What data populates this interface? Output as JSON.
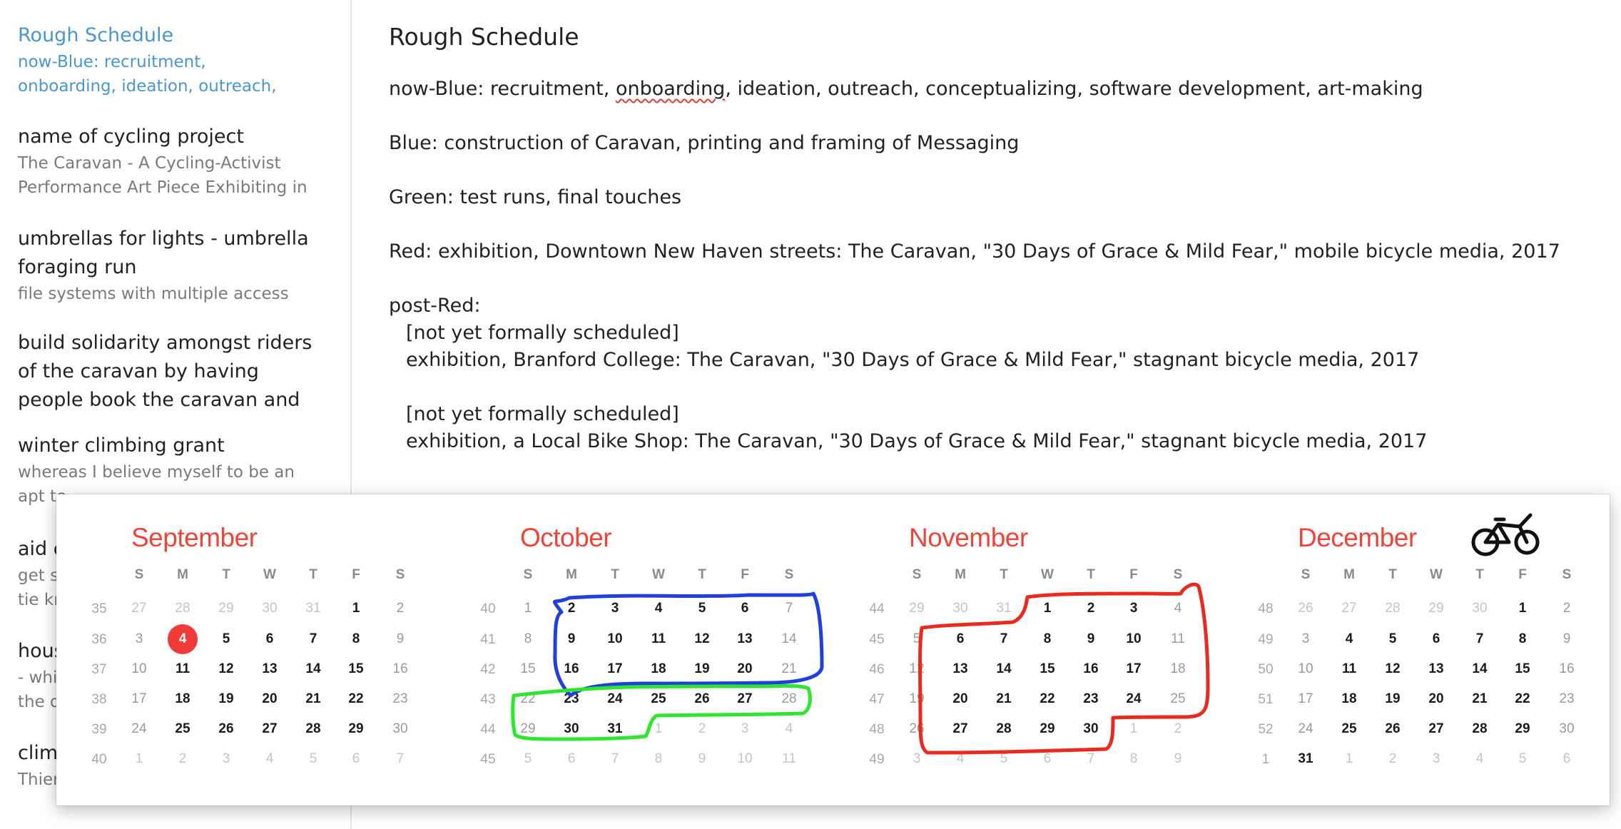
{
  "sidebar": {
    "notes": [
      {
        "title": "Rough Schedule",
        "preview": "now-Blue: recruitment,\nonboarding, ideation, outreach,",
        "active": true
      },
      {
        "title": "name of cycling project",
        "preview": "The Caravan - A Cycling-Activist\nPerformance Art Piece Exhibiting in"
      },
      {
        "title": "umbrellas for lights - umbrella\nforaging run",
        "preview": "file systems with multiple access"
      },
      {
        "title": "build solidarity amongst riders\nof the caravan by having\npeople book the caravan and",
        "preview": ""
      },
      {
        "title": "winter climbing grant",
        "preview": "whereas I believe myself to be an\napt te"
      },
      {
        "title": "aid c",
        "preview": "get sc\ntie kn"
      },
      {
        "title": "hous",
        "preview": "- whic\nthe d"
      },
      {
        "title": "clim",
        "preview": "Thier"
      }
    ]
  },
  "editor": {
    "title": "Rough Schedule",
    "line_now_blue_pre": "now-Blue: recruitment, ",
    "line_now_blue_misspelled": "onboarding",
    "line_now_blue_post": ", ideation, outreach, conceptualizing, software development, art-making",
    "line_blue": "Blue: construction of Caravan, printing and framing of Messaging",
    "line_green": "Green: test runs, final touches",
    "line_red": "Red: exhibition, Downtown New Haven streets: The Caravan, \"30 Days of Grace & Mild Fear,\" mobile bicycle media, 2017",
    "post_red_heading": "post-Red:",
    "post_red_1_status": "[not yet formally scheduled]",
    "post_red_1_detail": "exhibition, Branford College: The Caravan, \"30 Days of Grace & Mild Fear,\" stagnant bicycle media, 2017",
    "post_red_2_status": "[not yet formally scheduled]",
    "post_red_2_detail": "exhibition, a Local Bike Shop: The Caravan, \"30 Days of Grace & Mild Fear,\" stagnant bicycle media, 2017"
  },
  "calendar": {
    "weekday_labels": [
      "S",
      "M",
      "T",
      "W",
      "T",
      "F",
      "S"
    ],
    "today_color": "#ef3b36",
    "month_color": "#f0433a",
    "months": [
      {
        "name": "September",
        "weeks": [
          {
            "wk": "35",
            "days": [
              [
                "27",
                "dim"
              ],
              [
                "28",
                "dim"
              ],
              [
                "29",
                "dim"
              ],
              [
                "30",
                "dim"
              ],
              [
                "31",
                "dim"
              ],
              [
                "1",
                ""
              ],
              [
                "2",
                "weekend"
              ]
            ]
          },
          {
            "wk": "36",
            "days": [
              [
                "3",
                "weekend"
              ],
              [
                "4",
                "today"
              ],
              [
                "5",
                ""
              ],
              [
                "6",
                ""
              ],
              [
                "7",
                ""
              ],
              [
                "8",
                ""
              ],
              [
                "9",
                "weekend"
              ]
            ]
          },
          {
            "wk": "37",
            "days": [
              [
                "10",
                "weekend"
              ],
              [
                "11",
                ""
              ],
              [
                "12",
                ""
              ],
              [
                "13",
                ""
              ],
              [
                "14",
                ""
              ],
              [
                "15",
                ""
              ],
              [
                "16",
                "weekend"
              ]
            ]
          },
          {
            "wk": "38",
            "days": [
              [
                "17",
                "weekend"
              ],
              [
                "18",
                ""
              ],
              [
                "19",
                ""
              ],
              [
                "20",
                ""
              ],
              [
                "21",
                ""
              ],
              [
                "22",
                ""
              ],
              [
                "23",
                "weekend"
              ]
            ]
          },
          {
            "wk": "39",
            "days": [
              [
                "24",
                "weekend"
              ],
              [
                "25",
                ""
              ],
              [
                "26",
                ""
              ],
              [
                "27",
                ""
              ],
              [
                "28",
                ""
              ],
              [
                "29",
                ""
              ],
              [
                "30",
                "weekend"
              ]
            ]
          },
          {
            "wk": "40",
            "days": [
              [
                "1",
                "dim"
              ],
              [
                "2",
                "dim"
              ],
              [
                "3",
                "dim"
              ],
              [
                "4",
                "dim"
              ],
              [
                "5",
                "dim"
              ],
              [
                "6",
                "dim"
              ],
              [
                "7",
                "dim"
              ]
            ]
          }
        ]
      },
      {
        "name": "October",
        "weeks": [
          {
            "wk": "40",
            "days": [
              [
                "1",
                "weekend"
              ],
              [
                "2",
                ""
              ],
              [
                "3",
                ""
              ],
              [
                "4",
                ""
              ],
              [
                "5",
                ""
              ],
              [
                "6",
                ""
              ],
              [
                "7",
                "weekend"
              ]
            ]
          },
          {
            "wk": "41",
            "days": [
              [
                "8",
                "weekend"
              ],
              [
                "9",
                ""
              ],
              [
                "10",
                ""
              ],
              [
                "11",
                ""
              ],
              [
                "12",
                ""
              ],
              [
                "13",
                ""
              ],
              [
                "14",
                "weekend"
              ]
            ]
          },
          {
            "wk": "42",
            "days": [
              [
                "15",
                "weekend"
              ],
              [
                "16",
                ""
              ],
              [
                "17",
                ""
              ],
              [
                "18",
                ""
              ],
              [
                "19",
                ""
              ],
              [
                "20",
                ""
              ],
              [
                "21",
                "weekend"
              ]
            ]
          },
          {
            "wk": "43",
            "days": [
              [
                "22",
                "weekend"
              ],
              [
                "23",
                ""
              ],
              [
                "24",
                ""
              ],
              [
                "25",
                ""
              ],
              [
                "26",
                ""
              ],
              [
                "27",
                ""
              ],
              [
                "28",
                "weekend"
              ]
            ]
          },
          {
            "wk": "44",
            "days": [
              [
                "29",
                "weekend"
              ],
              [
                "30",
                ""
              ],
              [
                "31",
                ""
              ],
              [
                "1",
                "dim"
              ],
              [
                "2",
                "dim"
              ],
              [
                "3",
                "dim"
              ],
              [
                "4",
                "dim"
              ]
            ]
          },
          {
            "wk": "45",
            "days": [
              [
                "5",
                "dim"
              ],
              [
                "6",
                "dim"
              ],
              [
                "7",
                "dim"
              ],
              [
                "8",
                "dim"
              ],
              [
                "9",
                "dim"
              ],
              [
                "10",
                "dim"
              ],
              [
                "11",
                "dim"
              ]
            ]
          }
        ]
      },
      {
        "name": "November",
        "weeks": [
          {
            "wk": "44",
            "days": [
              [
                "29",
                "dim"
              ],
              [
                "30",
                "dim"
              ],
              [
                "31",
                "dim"
              ],
              [
                "1",
                ""
              ],
              [
                "2",
                ""
              ],
              [
                "3",
                ""
              ],
              [
                "4",
                "weekend"
              ]
            ]
          },
          {
            "wk": "45",
            "days": [
              [
                "5",
                "weekend"
              ],
              [
                "6",
                ""
              ],
              [
                "7",
                ""
              ],
              [
                "8",
                ""
              ],
              [
                "9",
                ""
              ],
              [
                "10",
                ""
              ],
              [
                "11",
                "weekend"
              ]
            ]
          },
          {
            "wk": "46",
            "days": [
              [
                "12",
                "weekend"
              ],
              [
                "13",
                ""
              ],
              [
                "14",
                ""
              ],
              [
                "15",
                ""
              ],
              [
                "16",
                ""
              ],
              [
                "17",
                ""
              ],
              [
                "18",
                "weekend"
              ]
            ]
          },
          {
            "wk": "47",
            "days": [
              [
                "19",
                "weekend"
              ],
              [
                "20",
                ""
              ],
              [
                "21",
                ""
              ],
              [
                "22",
                ""
              ],
              [
                "23",
                ""
              ],
              [
                "24",
                ""
              ],
              [
                "25",
                "weekend"
              ]
            ]
          },
          {
            "wk": "48",
            "days": [
              [
                "26",
                "weekend"
              ],
              [
                "27",
                ""
              ],
              [
                "28",
                ""
              ],
              [
                "29",
                ""
              ],
              [
                "30",
                ""
              ],
              [
                "1",
                "dim"
              ],
              [
                "2",
                "dim"
              ]
            ]
          },
          {
            "wk": "49",
            "days": [
              [
                "3",
                "dim"
              ],
              [
                "4",
                "dim"
              ],
              [
                "5",
                "dim"
              ],
              [
                "6",
                "dim"
              ],
              [
                "7",
                "dim"
              ],
              [
                "8",
                "dim"
              ],
              [
                "9",
                "dim"
              ]
            ]
          }
        ]
      },
      {
        "name": "December",
        "weeks": [
          {
            "wk": "48",
            "days": [
              [
                "26",
                "dim"
              ],
              [
                "27",
                "dim"
              ],
              [
                "28",
                "dim"
              ],
              [
                "29",
                "dim"
              ],
              [
                "30",
                "dim"
              ],
              [
                "1",
                ""
              ],
              [
                "2",
                "weekend"
              ]
            ]
          },
          {
            "wk": "49",
            "days": [
              [
                "3",
                "weekend"
              ],
              [
                "4",
                ""
              ],
              [
                "5",
                ""
              ],
              [
                "6",
                ""
              ],
              [
                "7",
                ""
              ],
              [
                "8",
                ""
              ],
              [
                "9",
                "weekend"
              ]
            ]
          },
          {
            "wk": "50",
            "days": [
              [
                "10",
                "weekend"
              ],
              [
                "11",
                ""
              ],
              [
                "12",
                ""
              ],
              [
                "13",
                ""
              ],
              [
                "14",
                ""
              ],
              [
                "15",
                ""
              ],
              [
                "16",
                "weekend"
              ]
            ]
          },
          {
            "wk": "51",
            "days": [
              [
                "17",
                "weekend"
              ],
              [
                "18",
                ""
              ],
              [
                "19",
                ""
              ],
              [
                "20",
                ""
              ],
              [
                "21",
                ""
              ],
              [
                "22",
                ""
              ],
              [
                "23",
                "weekend"
              ]
            ]
          },
          {
            "wk": "52",
            "days": [
              [
                "24",
                "weekend"
              ],
              [
                "25",
                ""
              ],
              [
                "26",
                ""
              ],
              [
                "27",
                ""
              ],
              [
                "28",
                ""
              ],
              [
                "29",
                ""
              ],
              [
                "30",
                "weekend"
              ]
            ]
          },
          {
            "wk": "1",
            "days": [
              [
                "31",
                ""
              ],
              [
                "1",
                "dim"
              ],
              [
                "2",
                "dim"
              ],
              [
                "3",
                "dim"
              ],
              [
                "4",
                "dim"
              ],
              [
                "5",
                "dim"
              ],
              [
                "6",
                "dim"
              ]
            ]
          }
        ]
      }
    ]
  },
  "annotations": {
    "blue_color": "#1f3fe0",
    "green_color": "#2ee62e",
    "red_color": "#ea2a1e",
    "sketch_color": "#111111",
    "sketch_icon": "bicycle-sketch-icon"
  }
}
